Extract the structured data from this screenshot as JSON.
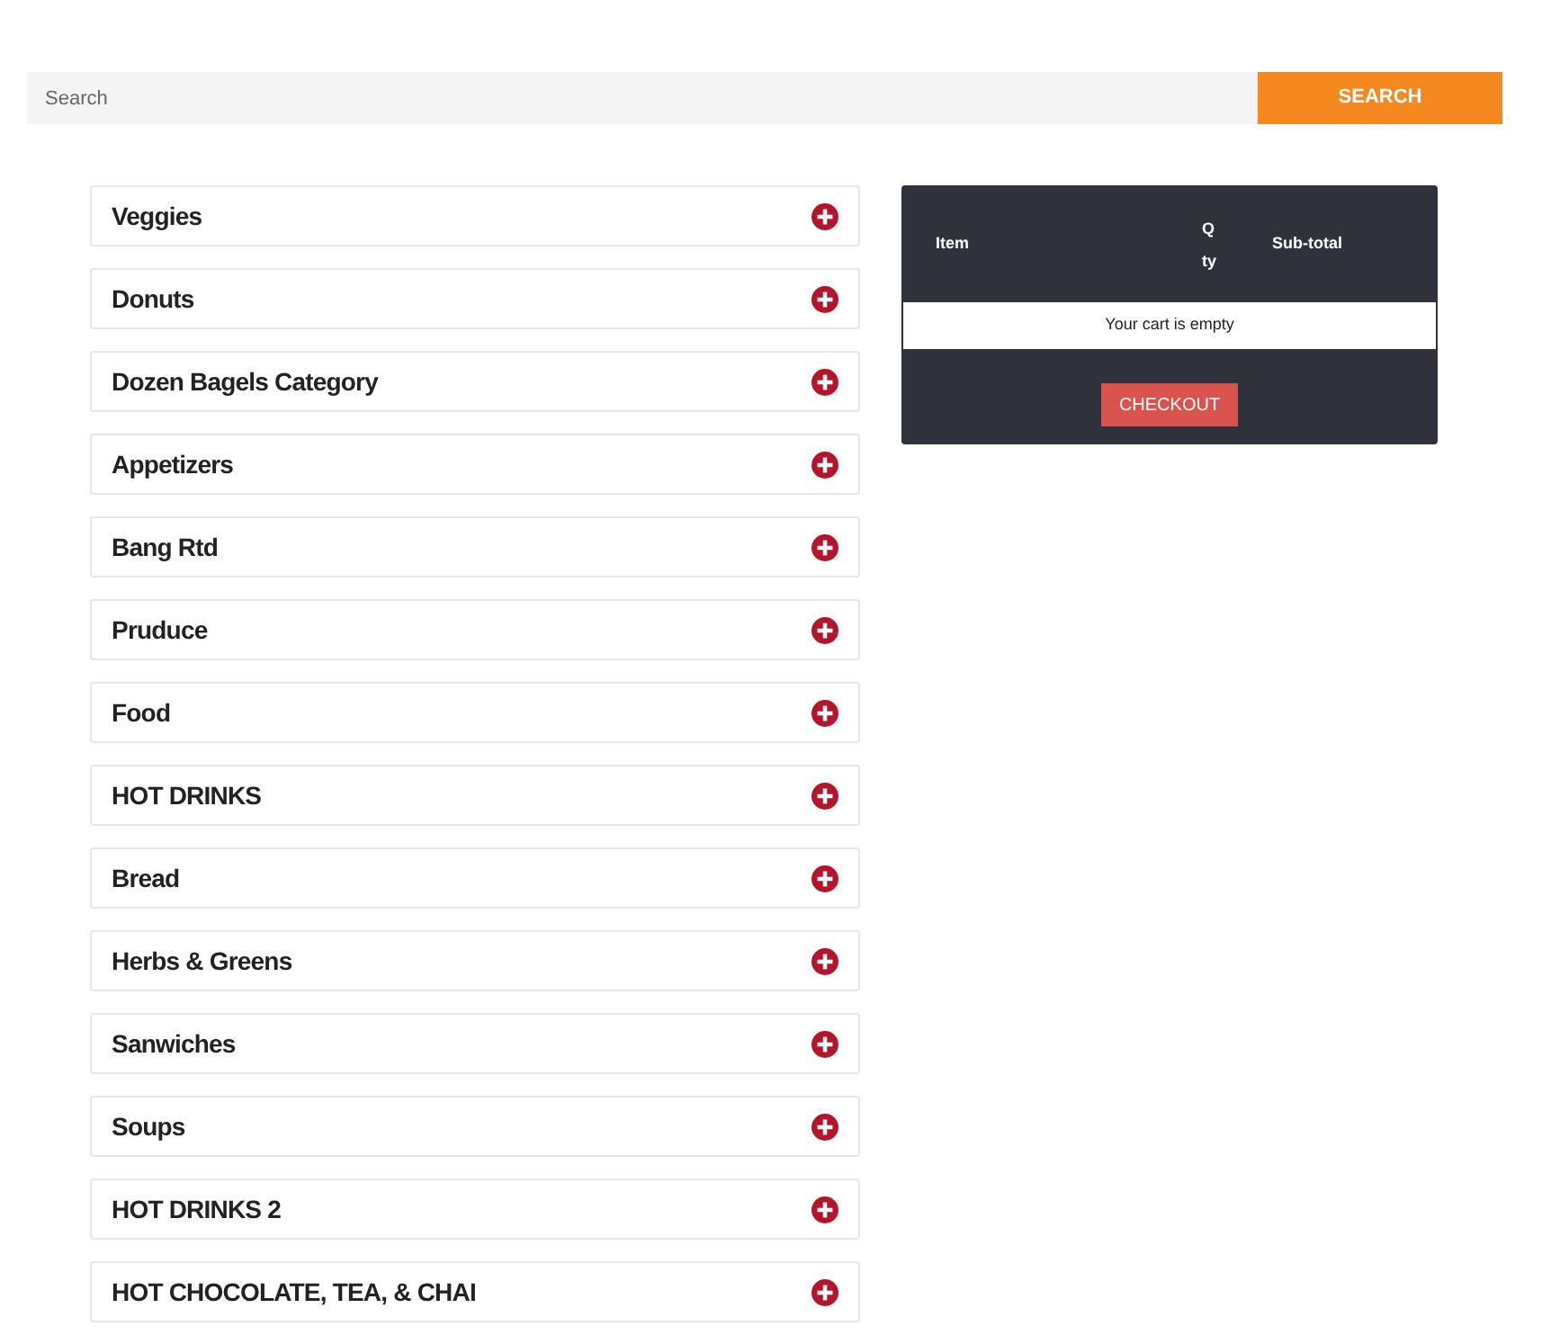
{
  "search": {
    "placeholder": "Search",
    "button": "SEARCH"
  },
  "categories": [
    {
      "label": "Veggies",
      "expanded": false
    },
    {
      "label": "Donuts",
      "expanded": false
    },
    {
      "label": "Dozen Bagels Category",
      "expanded": false
    },
    {
      "label": "Appetizers",
      "expanded": false
    },
    {
      "label": "Bang Rtd",
      "expanded": false
    },
    {
      "label": "Pruduce",
      "expanded": false
    },
    {
      "label": "Food",
      "expanded": false
    },
    {
      "label": "HOT DRINKS",
      "expanded": false
    },
    {
      "label": "Bread",
      "expanded": false
    },
    {
      "label": "Herbs & Greens",
      "expanded": false
    },
    {
      "label": "Sanwiches",
      "expanded": false
    },
    {
      "label": "Soups",
      "expanded": false
    },
    {
      "label": "HOT DRINKS 2",
      "expanded": false
    },
    {
      "label": "HOT CHOCOLATE, TEA, & CHAI",
      "expanded": false
    }
  ],
  "cart": {
    "columns": [
      "Item",
      "Qty",
      "Sub-total"
    ],
    "empty_message": "Your cart is empty",
    "checkout": "CHECKOUT"
  }
}
